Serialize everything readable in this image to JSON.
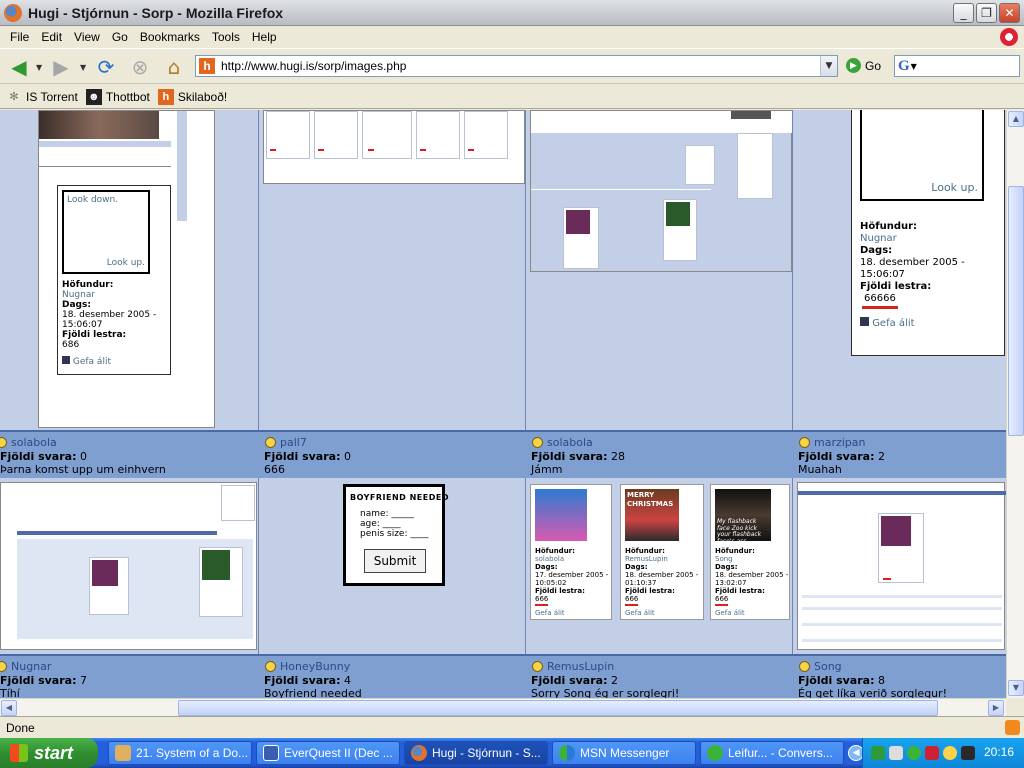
{
  "window": {
    "title": "Hugi - Stjórnun - Sorp - Mozilla Firefox",
    "min": "_",
    "max": "❐",
    "close": "✕"
  },
  "menu": [
    "File",
    "Edit",
    "View",
    "Go",
    "Bookmarks",
    "Tools",
    "Help"
  ],
  "nav": {
    "url": "http://www.hugi.is/sorp/images.php",
    "go_label": "Go",
    "site_icon": "h",
    "search_icon": "G"
  },
  "bookmarks": [
    {
      "label": "IS Torrent",
      "icon": "✻"
    },
    {
      "label": "Thottbot",
      "icon": "☻"
    },
    {
      "label": "Skilaboð!",
      "icon": "h"
    }
  ],
  "labels": {
    "fjoldi_svara": "Fjöldi svara:",
    "hofundur": "Höfundur:",
    "dags": "Dags:",
    "fjoldi_lestra": "Fjöldi lestra:",
    "gefa_alit": "Gefa álit",
    "look_down": "Look down.",
    "look_up": "Look up."
  },
  "top_posts": [
    {
      "author": "solabola",
      "replies": "0",
      "title": "Þarna komst upp um einhvern"
    },
    {
      "author": "pall7",
      "replies": "0",
      "title": "666"
    },
    {
      "author": "solabola",
      "replies": "28",
      "title": "Jámm"
    },
    {
      "author": "marzipan",
      "replies": "2",
      "title": "Muahah"
    }
  ],
  "bottom_posts": [
    {
      "author": "Nugnar",
      "replies": "7",
      "title": "Tíhí"
    },
    {
      "author": "HoneyBunny",
      "replies": "4",
      "title": "Boyfriend needed"
    },
    {
      "author": "RemusLupin",
      "replies": "2",
      "title": "Sorry Song ég er sorglegri!"
    },
    {
      "author": "Song",
      "replies": "8",
      "title": "Ég get líka verið sorglegur!"
    }
  ],
  "card1": {
    "author": "Nugnar",
    "date_line1": "18. desember 2005 -",
    "date_line2": "15:06:07",
    "reads": "686"
  },
  "card4": {
    "author": "Nugnar",
    "date_line1": "18. desember 2005 -",
    "date_line2": "15:06:07",
    "reads": "66666"
  },
  "boyfriend": {
    "heading": "BOYFRIEND NEEDED",
    "name": "name: _____",
    "age": "age: ____",
    "size": "penis size: ____",
    "submit": "Submit"
  },
  "xmas": {
    "banner": "MERRY CHRISTMAS",
    "caption": "My flashback face Zoo kick your flashback face's ass",
    "cards": [
      {
        "author": "solabola",
        "date_line1": "17. desember 2005 -",
        "date_line2": "10:05:02",
        "reads": "666"
      },
      {
        "author": "RemusLupin",
        "date_line1": "18. desember 2005 -",
        "date_line2": "01:10:37",
        "reads": "666"
      },
      {
        "author": "Song",
        "date_line1": "18. desember 2005 -",
        "date_line2": "13:02:07",
        "reads": "666"
      }
    ]
  },
  "status": "Done",
  "taskbar": {
    "start": "start",
    "tasks": [
      "21. System of a Do...",
      "EverQuest II (Dec ...",
      "Hugi - Stjórnun - S...",
      "MSN Messenger",
      "Leifur... - Convers..."
    ],
    "clock": "20:16"
  },
  "colors": {
    "accent": "#245edb",
    "page_bg": "#c3cfe6",
    "strip": "#7f9fd1",
    "read_underline": "#d82020"
  }
}
